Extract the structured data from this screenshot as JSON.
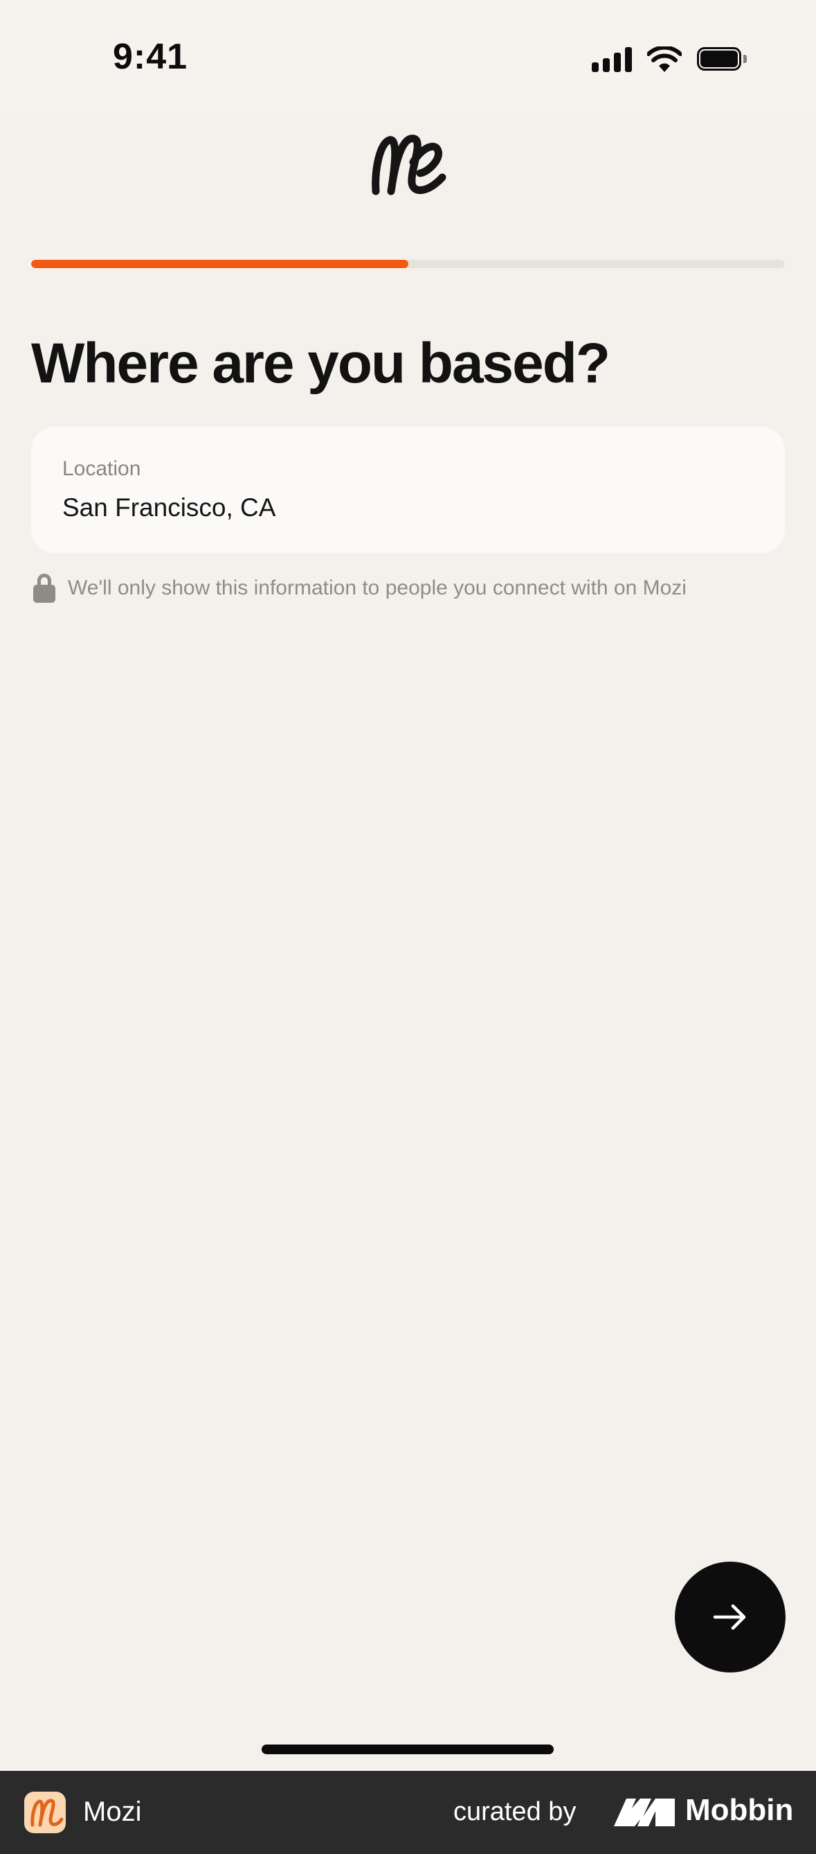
{
  "status_bar": {
    "time": "9:41",
    "icons": [
      "signal-icon",
      "wifi-icon",
      "battery-icon"
    ]
  },
  "header": {
    "logo_icon": "mozi-logo-icon"
  },
  "progress": {
    "fraction": 0.5,
    "fill_color": "#f15a12",
    "track_color": "#e7e2d9"
  },
  "main": {
    "title": "Where are you based?",
    "location_field": {
      "label": "Location",
      "value": "San Francisco, CA"
    },
    "privacy_note": "We'll only show this information to people you connect with on Mozi"
  },
  "actions": {
    "next_icon": "arrow-right-icon"
  },
  "footer": {
    "app_name": "Mozi",
    "curated_by": "curated by",
    "brand": "Mobbin"
  }
}
